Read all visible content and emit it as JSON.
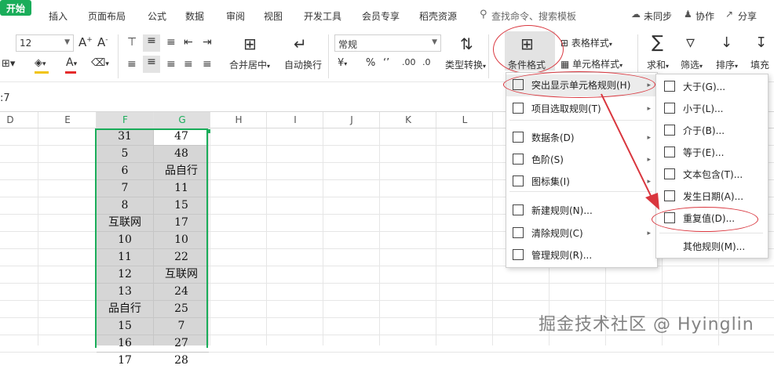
{
  "tabs": [
    "开始",
    "插入",
    "页面布局",
    "公式",
    "数据",
    "审阅",
    "视图",
    "开发工具",
    "会员专享",
    "稻壳资源"
  ],
  "search_placeholder": "查找命令、搜索模板",
  "right_actions": [
    "未同步",
    "协作",
    "分享"
  ],
  "ribbon": {
    "font_size": "12",
    "number_format": "常规",
    "merge_label": "合并居中",
    "wrap_label": "自动换行",
    "type_convert_label": "类型转换",
    "cond_format_label": "条件格式",
    "table_style_label": "表格样式",
    "cell_style_label": "单元格样式",
    "sum_label": "求和",
    "filter_label": "筛选",
    "sort_label": "排序",
    "fill_label": "填充"
  },
  "formula_bar": {
    "cell_ref": ":7"
  },
  "columns": [
    "D",
    "E",
    "F",
    "G",
    "H",
    "I",
    "J",
    "K",
    "L"
  ],
  "rows": [
    [
      "31",
      "47"
    ],
    [
      "5",
      "48"
    ],
    [
      "6",
      "品自行"
    ],
    [
      "7",
      "11"
    ],
    [
      "8",
      "15"
    ],
    [
      "互联网",
      "17"
    ],
    [
      "10",
      "10"
    ],
    [
      "11",
      "22"
    ],
    [
      "12",
      "互联网"
    ],
    [
      "13",
      "24"
    ],
    [
      "品自行",
      "25"
    ],
    [
      "15",
      "7"
    ],
    [
      "16",
      "27"
    ],
    [
      "17",
      "28"
    ]
  ],
  "menu_main": [
    {
      "label": "突出显示单元格规则(H)",
      "icon": "highlight-rules-icon",
      "submenu": true
    },
    {
      "label": "项目选取规则(T)",
      "icon": "top-rules-icon",
      "submenu": true
    },
    {
      "label": "数据条(D)",
      "icon": "data-bars-icon",
      "submenu": true
    },
    {
      "label": "色阶(S)",
      "icon": "color-scale-icon",
      "submenu": true
    },
    {
      "label": "图标集(I)",
      "icon": "icon-set-icon",
      "submenu": true
    },
    {
      "label": "新建规则(N)...",
      "icon": "new-rule-icon",
      "submenu": false
    },
    {
      "label": "清除规则(C)",
      "icon": "clear-rules-icon",
      "submenu": true
    },
    {
      "label": "管理规则(R)...",
      "icon": "manage-rules-icon",
      "submenu": false
    }
  ],
  "menu_sub": [
    {
      "label": "大于(G)..."
    },
    {
      "label": "小于(L)..."
    },
    {
      "label": "介于(B)..."
    },
    {
      "label": "等于(E)..."
    },
    {
      "label": "文本包含(T)..."
    },
    {
      "label": "发生日期(A)..."
    },
    {
      "label": "重复值(D)..."
    },
    {
      "label": "其他规则(M)..."
    }
  ],
  "watermark": "掘金技术社区 @ Hyinglin",
  "accent_color": "#1aad5a",
  "annotation_color": "#d9363e"
}
